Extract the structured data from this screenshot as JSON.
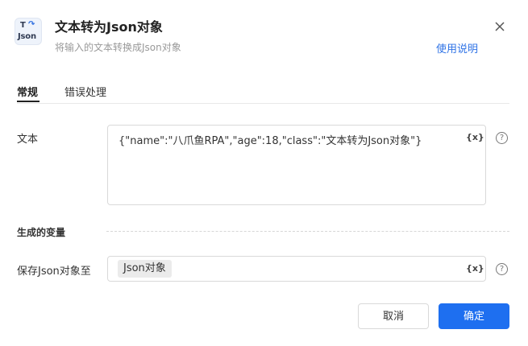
{
  "dialog": {
    "icon": {
      "line1": "T",
      "line2": "Json",
      "name": "text-to-json-icon"
    },
    "title": "文本转为Json对象",
    "subtitle": "将输入的文本转换成Json对象",
    "help_link": "使用说明"
  },
  "tabs": [
    {
      "label": "常规",
      "active": true
    },
    {
      "label": "错误处理",
      "active": false
    }
  ],
  "fields": {
    "text_label": "文本",
    "text_value": "{\"name\":\"八爪鱼RPA\",\"age\":18,\"class\":\"文本转为Json对象\"}",
    "variable_button": "{x}",
    "help_icon": "?"
  },
  "section": {
    "output_title": "生成的变量",
    "save_label": "保存Json对象至",
    "save_value": "Json对象"
  },
  "footer": {
    "cancel_label": "取消",
    "ok_label": "确定"
  },
  "colors": {
    "accent": "#1e6ff0",
    "link": "#2f73e6"
  }
}
